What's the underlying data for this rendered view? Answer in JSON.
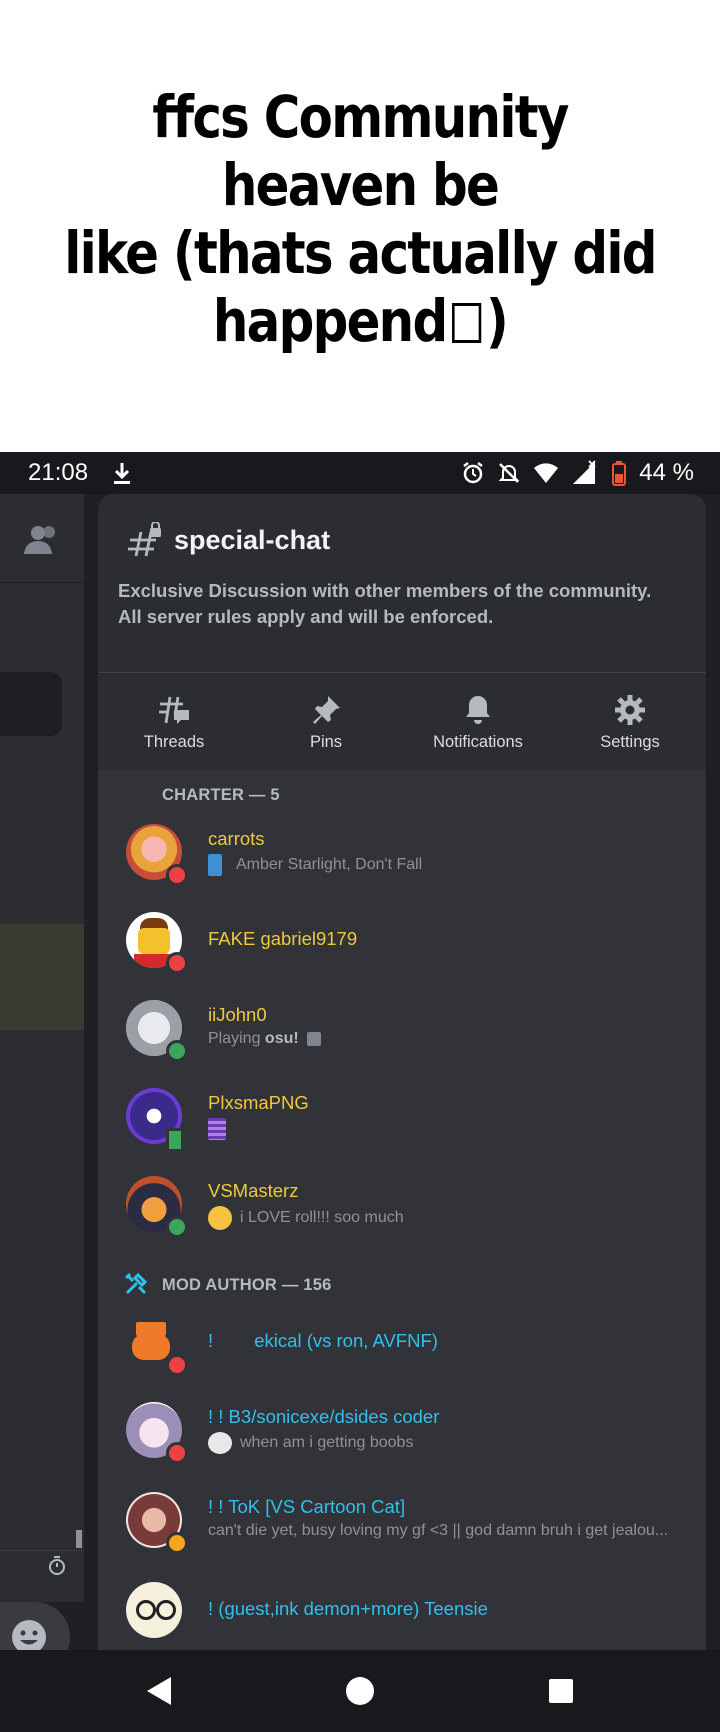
{
  "caption": {
    "line1": "ffcs Community heaven be",
    "line2": "like (thats actually did",
    "line3": "happend",
    "line3_end": ")"
  },
  "statusbar": {
    "time": "21:08",
    "battery": "44 %"
  },
  "channel": {
    "name": "special-chat",
    "description": "Exclusive Discussion with other members of the community. All server rules apply and will be enforced."
  },
  "actions": [
    {
      "label": "Threads",
      "icon": "threads-icon"
    },
    {
      "label": "Pins",
      "icon": "pin-icon"
    },
    {
      "label": "Notifications",
      "icon": "bell-icon"
    },
    {
      "label": "Settings",
      "icon": "gear-icon"
    }
  ],
  "sections": [
    {
      "title": "CHARTER — 5"
    },
    {
      "title": "MOD AUTHOR — 156"
    }
  ],
  "members": [
    {
      "name": "carrots",
      "status": "Amber Starlight, Don't Fall",
      "color": "#f0c93a"
    },
    {
      "name": "FAKE gabriel9179",
      "status": "",
      "color": "#f0c93a"
    },
    {
      "name": "iiJohn0",
      "status_prefix": "Playing ",
      "status_bold": "osu!",
      "color": "#f0c93a"
    },
    {
      "name": "PlxsmaPNG",
      "status": "",
      "color": "#f0c93a"
    },
    {
      "name": "VSMasterz",
      "status": "i LOVE roll!!! soo much",
      "color": "#f0c93a"
    },
    {
      "name": "!        ekical (vs ron, AVFNF)",
      "status": "",
      "color": "#2fc0ec"
    },
    {
      "name": "! ! B3/sonicexe/dsides coder",
      "status": "when am i getting boobs",
      "color": "#2fc0ec"
    },
    {
      "name": "! ! ToK [VS Cartoon Cat]",
      "status": "can't die yet, busy loving my gf <3 || god damn bruh i get jealou...",
      "color": "#2fc0ec"
    },
    {
      "name": "! (guest,ink demon+more) Teensie",
      "status": "",
      "color": "#2fc0ec"
    }
  ]
}
